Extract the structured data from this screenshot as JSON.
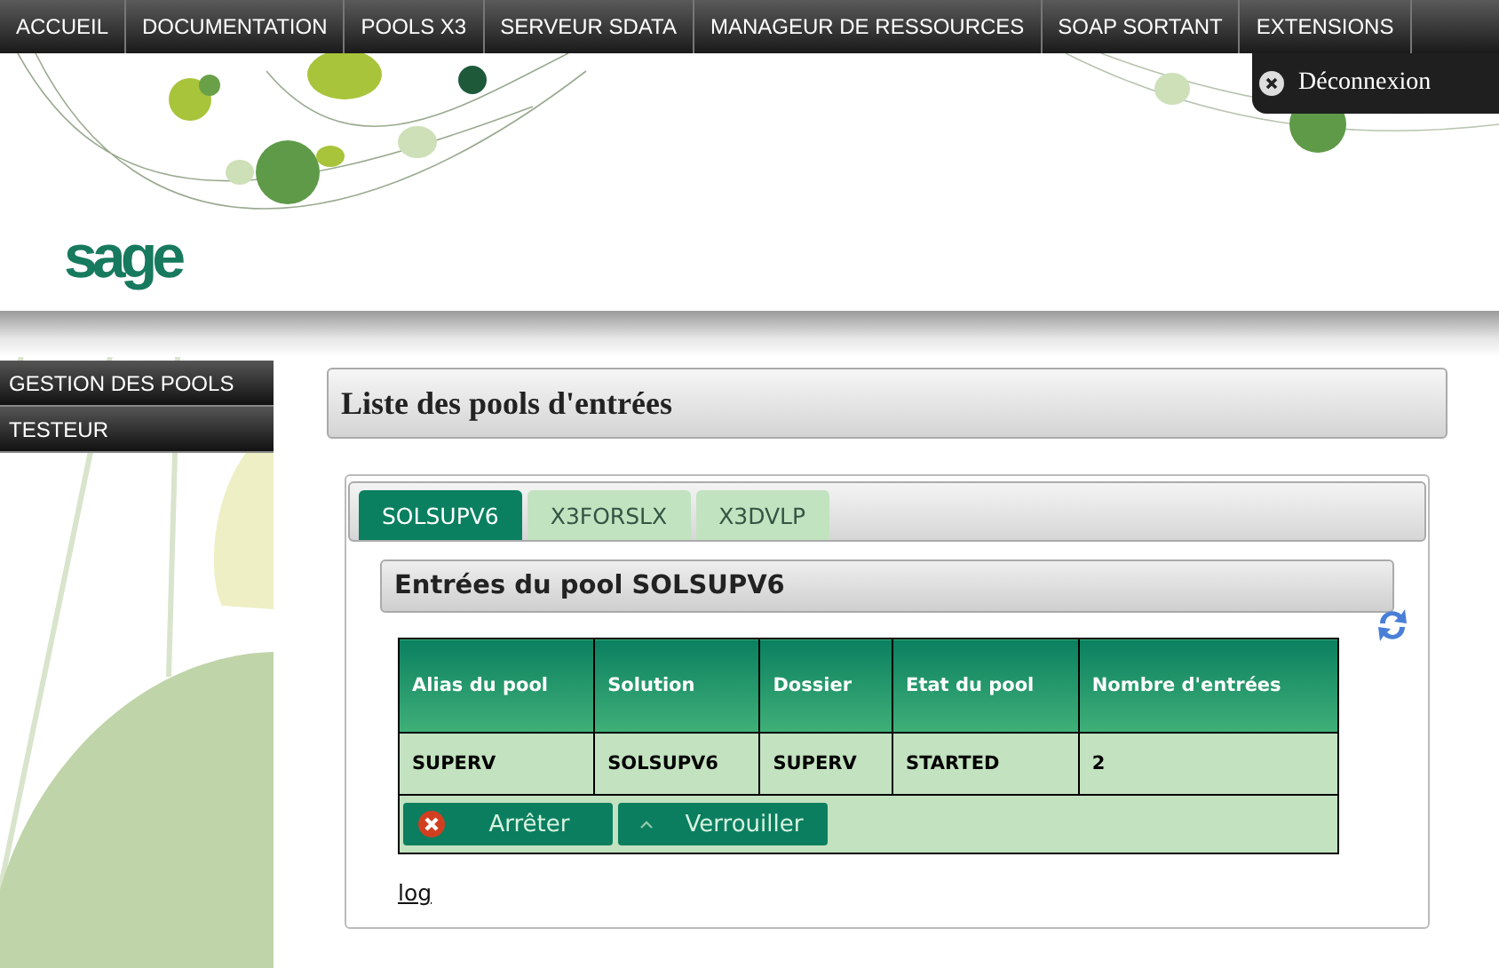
{
  "nav": {
    "items": [
      {
        "label": "ACCUEIL"
      },
      {
        "label": "DOCUMENTATION"
      },
      {
        "label": "POOLS X3"
      },
      {
        "label": "SERVEUR SDATA"
      },
      {
        "label": "MANAGEUR DE RESSOURCES"
      },
      {
        "label": "SOAP SORTANT"
      },
      {
        "label": "EXTENSIONS"
      }
    ],
    "logout": {
      "label": "Déconnexion"
    }
  },
  "logo": {
    "text": "sage"
  },
  "sidebar": {
    "items": [
      {
        "label": "GESTION DES POOLS"
      },
      {
        "label": "TESTEUR"
      }
    ]
  },
  "page_title": "Liste des pools d'entrées",
  "tabs": [
    {
      "label": "SOLSUPV6",
      "selected": true
    },
    {
      "label": "X3FORSLX",
      "selected": false
    },
    {
      "label": "X3DVLP",
      "selected": false
    }
  ],
  "section_title": "Entrées du pool SOLSUPV6",
  "table": {
    "columns": [
      "Alias du pool",
      "Solution",
      "Dossier",
      "Etat du pool",
      "Nombre d'entrées"
    ],
    "rows": [
      [
        "SUPERV",
        "SOLSUPV6",
        "SUPERV",
        "STARTED",
        "2"
      ]
    ]
  },
  "actions": [
    {
      "label": "Arrêter",
      "kind": "stop"
    },
    {
      "label": "Verrouiller",
      "kind": "lock"
    }
  ],
  "link": "log"
}
